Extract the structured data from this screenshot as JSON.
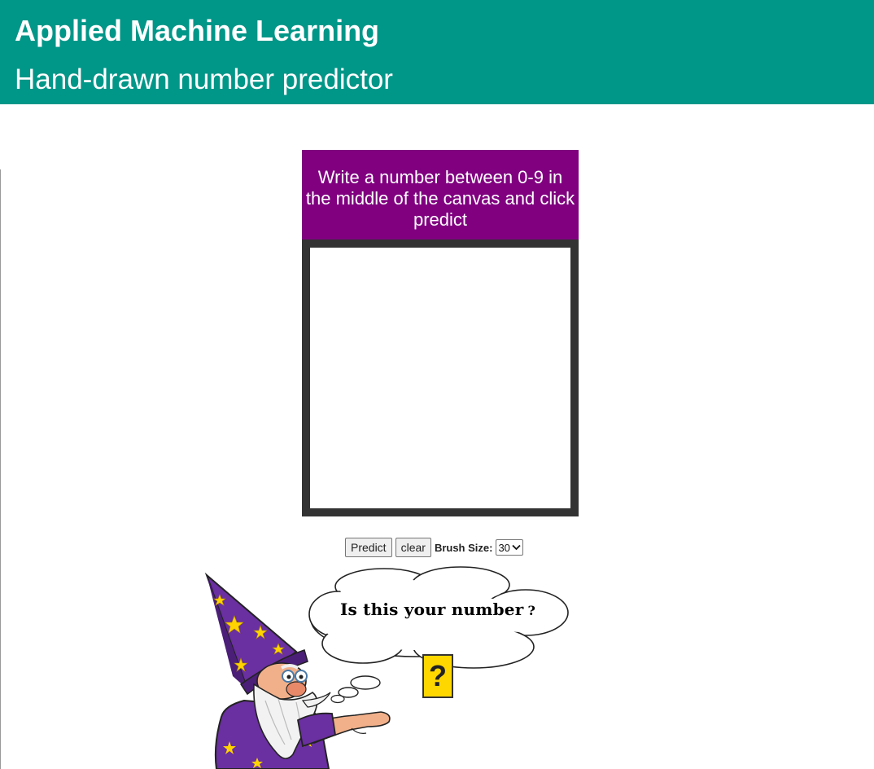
{
  "header": {
    "title": "Applied Machine Learning",
    "subtitle": "Hand-drawn number predictor",
    "background_color": "#009688"
  },
  "panel": {
    "instructions": "Write a number between 0-9 in the middle of the canvas and click predict",
    "background_color": "#800080",
    "canvas_border_color": "#333333"
  },
  "controls": {
    "predict_label": "Predict",
    "clear_label": "clear",
    "brush_size_label": "Brush Size:",
    "brush_size_value": "30"
  },
  "result": {
    "bubble_text": "Is this your number",
    "bubble_punct": "?",
    "predicted_value": "?",
    "answer_box_color": "#ffd700"
  },
  "illustration": {
    "name": "wizard-pointing",
    "hat_color": "#6a2fa0",
    "star_color": "#ffd400"
  }
}
